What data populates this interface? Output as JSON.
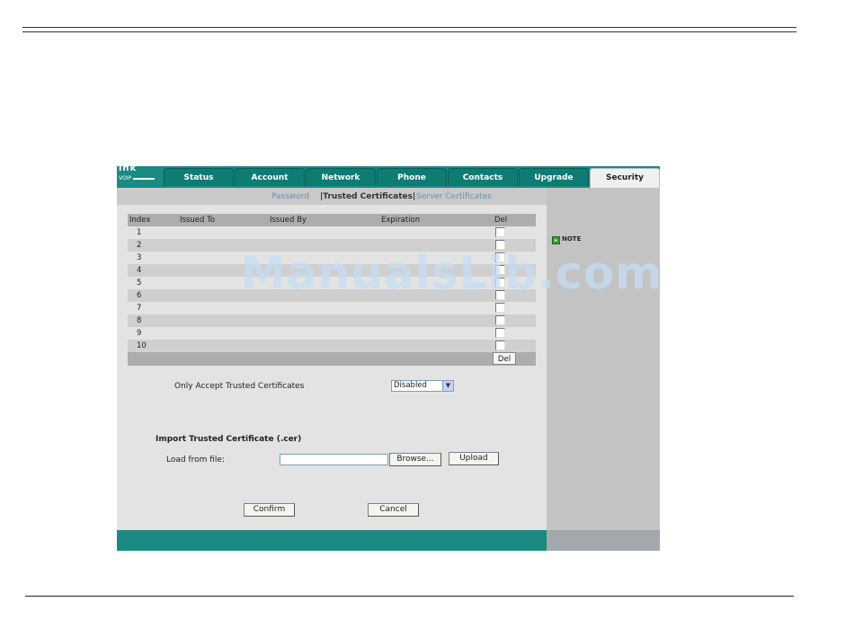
{
  "logo": {
    "line1": "ink",
    "line2": "VOIP"
  },
  "tabs": [
    {
      "label": "Status",
      "active": false
    },
    {
      "label": "Account",
      "active": false
    },
    {
      "label": "Network",
      "active": false
    },
    {
      "label": "Phone",
      "active": false
    },
    {
      "label": "Contacts",
      "active": false
    },
    {
      "label": "Upgrade",
      "active": false
    },
    {
      "label": "Security",
      "active": true
    }
  ],
  "subnav": {
    "password": "Password",
    "trusted": "|Trusted Certificates|",
    "server": "Server Certificates"
  },
  "table": {
    "headers": {
      "index": "Index",
      "issued_to": "Issued To",
      "issued_by": "Issued By",
      "expiration": "Expiration",
      "del": "Del"
    },
    "rows": [
      "1",
      "2",
      "3",
      "4",
      "5",
      "6",
      "7",
      "8",
      "9",
      "10"
    ],
    "del_button": "Del"
  },
  "trusted_only": {
    "label": "Only Accept Trusted Certificates",
    "value": "Disabled"
  },
  "import": {
    "title": "Import Trusted Certificate (.cer)",
    "load_label": "Load from file:",
    "browse": "Browse...",
    "upload": "Upload"
  },
  "actions": {
    "confirm": "Confirm",
    "cancel": "Cancel"
  },
  "side": {
    "note": "NOTE"
  },
  "watermark": "ManualsLib.com",
  "colors": {
    "teal": "#1a8a82",
    "tab": "#0f7c74",
    "side": "#c3c3c3"
  }
}
